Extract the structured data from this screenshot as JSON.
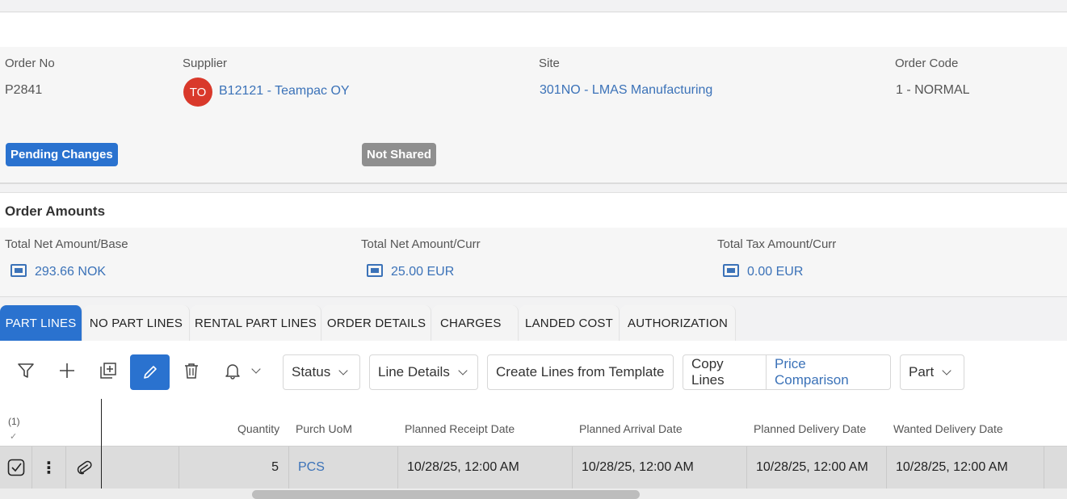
{
  "header": {
    "order_no": {
      "label": "Order No",
      "value": "P2841"
    },
    "supplier": {
      "label": "Supplier",
      "avatar": "TO",
      "value": "B12121 - Teampac OY"
    },
    "site": {
      "label": "Site",
      "value": "301NO - LMAS Manufacturing"
    },
    "order_code": {
      "label": "Order Code",
      "value": "1 - NORMAL"
    },
    "badges": {
      "pending": "Pending Changes",
      "shared": "Not Shared"
    }
  },
  "amounts": {
    "title": "Order Amounts",
    "net_base": {
      "label": "Total Net Amount/Base",
      "value": "293.66 NOK"
    },
    "net_curr": {
      "label": "Total Net Amount/Curr",
      "value": "25.00 EUR"
    },
    "tax_curr": {
      "label": "Total Tax Amount/Curr",
      "value": "0.00 EUR"
    }
  },
  "tabs": [
    "PART LINES",
    "NO PART LINES",
    "RENTAL PART LINES",
    "ORDER DETAILS",
    "CHARGES",
    "LANDED COST",
    "AUTHORIZATION"
  ],
  "toolbar": {
    "status": "Status",
    "line_details": "Line Details",
    "create_from_template": "Create Lines from Template",
    "copy_lines": "Copy Lines",
    "price_comparison": "Price Comparison",
    "part": "Part"
  },
  "grid": {
    "selection_count": "(1)",
    "columns": [
      "Quantity",
      "Purch UoM",
      "Planned Receipt Date",
      "Planned Arrival Date",
      "Planned Delivery Date",
      "Wanted Delivery Date"
    ],
    "rows": [
      {
        "quantity": "5",
        "uom": "PCS",
        "receipt": "10/28/25, 12:00 AM",
        "arrival": "10/28/25, 12:00 AM",
        "delivery": "10/28/25, 12:00 AM",
        "wanted": "10/28/25, 12:00 AM"
      }
    ]
  },
  "colors": {
    "accent": "#2a72cf",
    "link": "#3b72b8",
    "avatar": "#d9392b",
    "badge_grey": "#8f8f8f"
  }
}
